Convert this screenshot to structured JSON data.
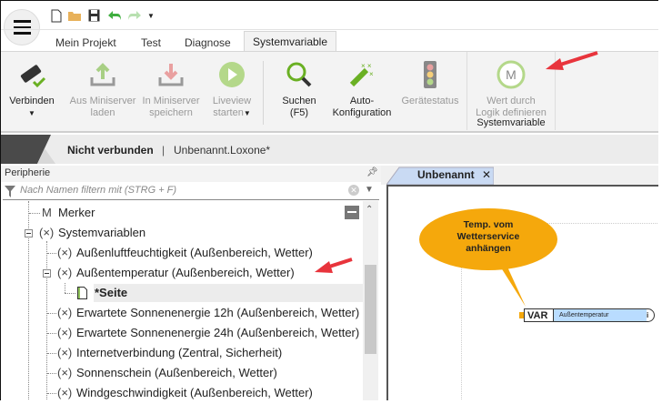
{
  "quick_access": {
    "icons": [
      "new-file-icon",
      "open-folder-icon",
      "save-icon",
      "undo-icon",
      "redo-icon",
      "customize-dropdown-icon"
    ]
  },
  "tabs": [
    "Mein Projekt",
    "Test",
    "Diagnose",
    "Systemvariable"
  ],
  "ribbon": {
    "connect": {
      "l1": "Verbinden"
    },
    "load": {
      "l1": "Aus Miniserver",
      "l2": "laden"
    },
    "save": {
      "l1": "In Miniserver",
      "l2": "speichern"
    },
    "liveview": {
      "l1": "Liveview",
      "l2": "starten"
    },
    "search": {
      "l1": "Suchen",
      "l2": "(F5)"
    },
    "autoconf": {
      "l1": "Auto-",
      "l2": "Konfiguration"
    },
    "devstatus": {
      "l1": "Gerätestatus"
    },
    "logic": {
      "l1": "Wert durch",
      "l2": "Logik definieren",
      "icon_letter": "M"
    },
    "group_label": "Systemvariable"
  },
  "status": {
    "connection": "Nicht verbunden",
    "separator": "|",
    "file": "Unbenannt.Loxone*"
  },
  "periphery": {
    "title": "Peripherie",
    "filter_placeholder": "Nach Namen filtern mit (STRG + F)"
  },
  "tree": [
    {
      "prefix": "M",
      "label": "Merker"
    },
    {
      "prefix": "(×)",
      "label": "Systemvariablen"
    },
    {
      "prefix": "(×)",
      "label": "Außenluftfeuchtigkeit (Außenbereich, Wetter)"
    },
    {
      "prefix": "(×)",
      "label": "Außentemperatur (Außenbereich, Wetter)"
    },
    {
      "prefix": "",
      "label": "*Seite"
    },
    {
      "prefix": "(×)",
      "label": "Erwartete Sonnenenergie 12h (Außenbereich, Wetter)"
    },
    {
      "prefix": "(×)",
      "label": "Erwartete Sonnenenergie 24h (Außenbereich, Wetter)"
    },
    {
      "prefix": "(×)",
      "label": "Internetverbindung (Zentral, Sicherheit)"
    },
    {
      "prefix": "(×)",
      "label": "Sonnenschein (Außenbereich, Wetter)"
    },
    {
      "prefix": "(×)",
      "label": "Windgeschwindigkeit (Außenbereich, Wetter)"
    }
  ],
  "document": {
    "tab": "Unbenannt",
    "callout": [
      "Temp. vom",
      "Wetterservice",
      "anhängen"
    ],
    "block_type": "VAR",
    "block_name": "Außentemperatur"
  },
  "colors": {
    "accent_green": "#7ab51d",
    "arrow_red": "#e8343c",
    "callout": "#f5a80c",
    "block_blue": "#b9dcff"
  }
}
